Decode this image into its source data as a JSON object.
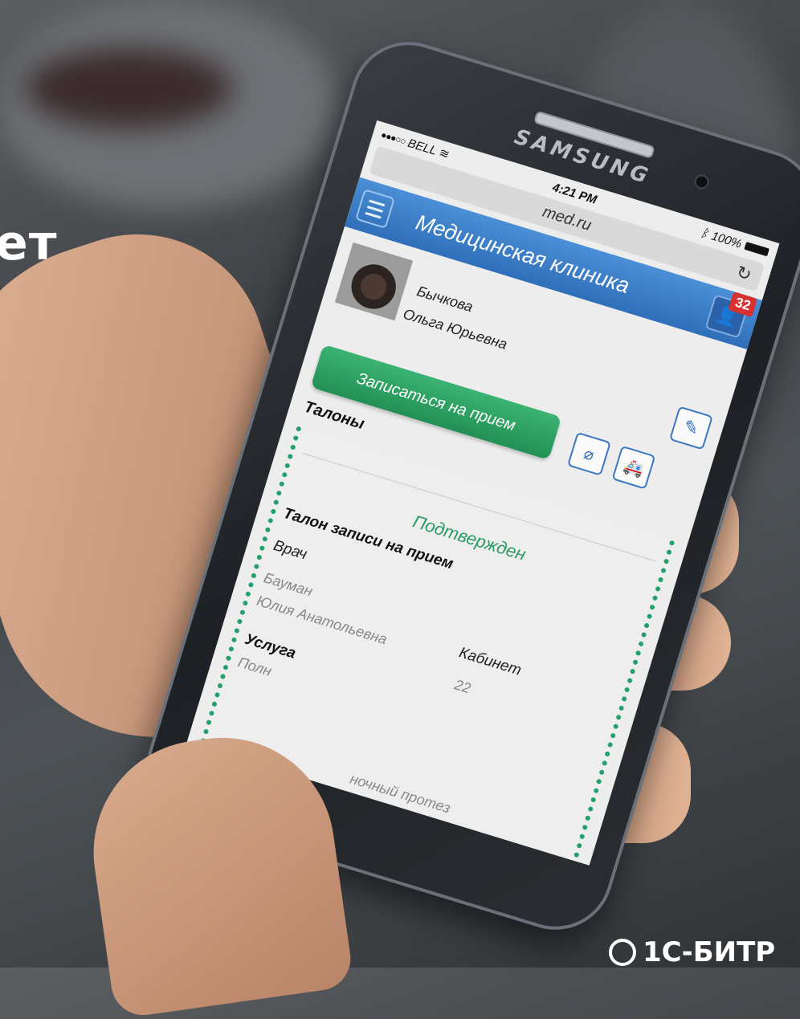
{
  "background": {
    "partial_heading": "ет",
    "brand_partial": "1С-БИТР"
  },
  "phone": {
    "brand": "SAMSUNG",
    "status_bar": {
      "carrier": "BELL",
      "time": "4:21 PM",
      "battery": "100%"
    },
    "url": "med.ru",
    "app": {
      "title": "Медицинская клиника",
      "notification_count": "32",
      "profile": {
        "last_name": "Бычкова",
        "first_middle_name": "Ольга Юрьевна"
      },
      "record_button_label": "Записаться на прием",
      "section_title": "Талоны",
      "ticket": {
        "status": "Подтвержден",
        "title": "Талон записи на прием",
        "doctor_label": "Врач",
        "doctor_last_name": "Бауман",
        "doctor_first_middle_name": "Юлия Анатольевна",
        "room_label": "Кабинет",
        "room_value": "22",
        "service_label": "Услуга",
        "service_value_start": "Полн",
        "service_value_end": "ночный протез"
      }
    }
  },
  "colors": {
    "app_bar": "#3a7cc8",
    "primary_button": "#2ea065",
    "status_confirmed": "#2a9b63",
    "badge": "#d8312f"
  }
}
